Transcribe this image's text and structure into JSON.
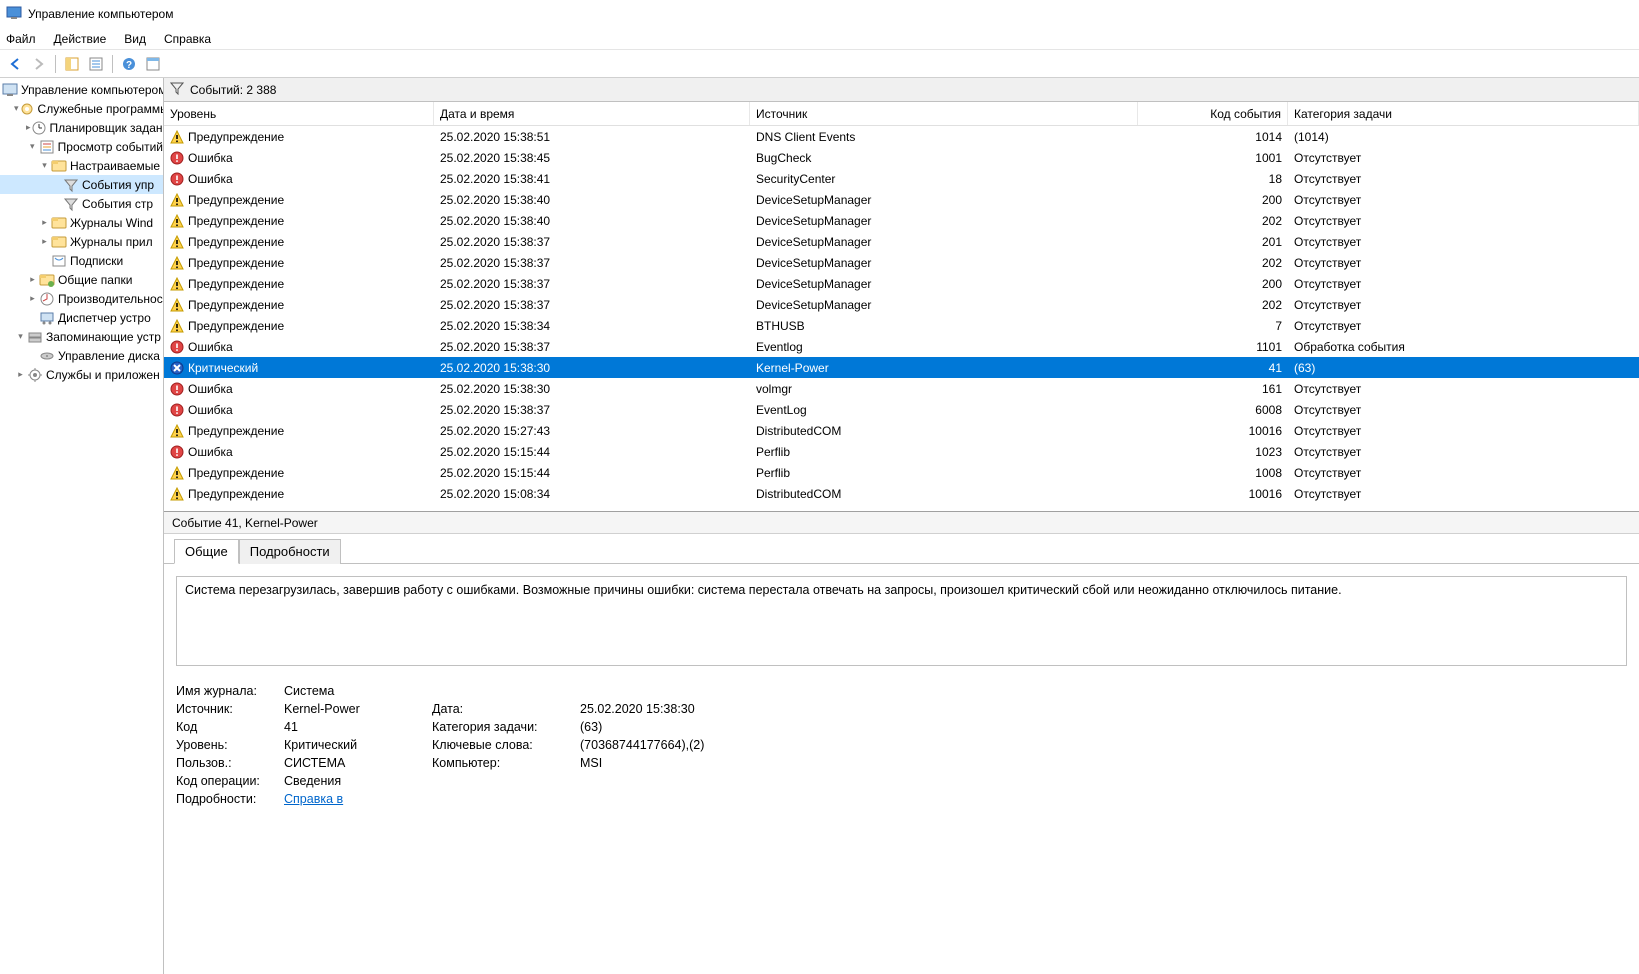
{
  "window_title": "Управление компьютером",
  "menu": {
    "file": "Файл",
    "action": "Действие",
    "view": "Вид",
    "help": "Справка"
  },
  "tree": [
    {
      "label": "Управление компьютером",
      "indent": 0,
      "icon": "computer-icon",
      "expander": ""
    },
    {
      "label": "Служебные программы",
      "indent": 1,
      "icon": "tools-icon",
      "expander": "▾"
    },
    {
      "label": "Планировщик заданий",
      "indent": 2,
      "icon": "scheduler-icon",
      "expander": "▸"
    },
    {
      "label": "Просмотр событий",
      "indent": 2,
      "icon": "eventviewer-icon",
      "expander": "▾"
    },
    {
      "label": "Настраиваемые",
      "indent": 3,
      "icon": "folder-icon",
      "expander": "▾"
    },
    {
      "label": "События управления",
      "indent": 4,
      "icon": "filter-icon",
      "expander": "",
      "selected": true,
      "short": "События упр"
    },
    {
      "label": "События строки",
      "indent": 4,
      "icon": "filter-icon",
      "expander": "",
      "short": "События стр"
    },
    {
      "label": "Журналы Windows",
      "indent": 3,
      "icon": "folder-icon",
      "expander": "▸",
      "short": "Журналы Wind"
    },
    {
      "label": "Журналы приложений",
      "indent": 3,
      "icon": "folder-icon",
      "expander": "▸",
      "short": "Журналы прил"
    },
    {
      "label": "Подписки",
      "indent": 3,
      "icon": "subs-icon",
      "expander": ""
    },
    {
      "label": "Общие папки",
      "indent": 2,
      "icon": "shared-icon",
      "expander": "▸"
    },
    {
      "label": "Производительность",
      "indent": 2,
      "icon": "perf-icon",
      "expander": "▸",
      "short": "Производительнос"
    },
    {
      "label": "Диспетчер устройств",
      "indent": 2,
      "icon": "devmgr-icon",
      "expander": "",
      "short": "Диспетчер устро"
    },
    {
      "label": "Запоминающие устройства",
      "indent": 1,
      "icon": "storage-icon",
      "expander": "▾",
      "short": "Запоминающие устр"
    },
    {
      "label": "Управление дисками",
      "indent": 2,
      "icon": "diskmgr-icon",
      "expander": "",
      "short": "Управление диска"
    },
    {
      "label": "Службы и приложения",
      "indent": 1,
      "icon": "services-icon",
      "expander": "▸",
      "short": "Службы и приложен"
    }
  ],
  "count_label": "Событий: 2 388",
  "columns": {
    "level": "Уровень",
    "date": "Дата и время",
    "source": "Источник",
    "code": "Код события",
    "category": "Категория задачи"
  },
  "events": [
    {
      "level": "warning",
      "level_text": "Предупреждение",
      "date": "25.02.2020 15:38:51",
      "source": "DNS Client Events",
      "code": "1014",
      "category": "(1014)"
    },
    {
      "level": "error",
      "level_text": "Ошибка",
      "date": "25.02.2020 15:38:45",
      "source": "BugCheck",
      "code": "1001",
      "category": "Отсутствует"
    },
    {
      "level": "error",
      "level_text": "Ошибка",
      "date": "25.02.2020 15:38:41",
      "source": "SecurityCenter",
      "code": "18",
      "category": "Отсутствует"
    },
    {
      "level": "warning",
      "level_text": "Предупреждение",
      "date": "25.02.2020 15:38:40",
      "source": "DeviceSetupManager",
      "code": "200",
      "category": "Отсутствует"
    },
    {
      "level": "warning",
      "level_text": "Предупреждение",
      "date": "25.02.2020 15:38:40",
      "source": "DeviceSetupManager",
      "code": "202",
      "category": "Отсутствует"
    },
    {
      "level": "warning",
      "level_text": "Предупреждение",
      "date": "25.02.2020 15:38:37",
      "source": "DeviceSetupManager",
      "code": "201",
      "category": "Отсутствует"
    },
    {
      "level": "warning",
      "level_text": "Предупреждение",
      "date": "25.02.2020 15:38:37",
      "source": "DeviceSetupManager",
      "code": "202",
      "category": "Отсутствует"
    },
    {
      "level": "warning",
      "level_text": "Предупреждение",
      "date": "25.02.2020 15:38:37",
      "source": "DeviceSetupManager",
      "code": "200",
      "category": "Отсутствует"
    },
    {
      "level": "warning",
      "level_text": "Предупреждение",
      "date": "25.02.2020 15:38:37",
      "source": "DeviceSetupManager",
      "code": "202",
      "category": "Отсутствует"
    },
    {
      "level": "warning",
      "level_text": "Предупреждение",
      "date": "25.02.2020 15:38:34",
      "source": "BTHUSB",
      "code": "7",
      "category": "Отсутствует"
    },
    {
      "level": "error",
      "level_text": "Ошибка",
      "date": "25.02.2020 15:38:37",
      "source": "Eventlog",
      "code": "1101",
      "category": "Обработка события"
    },
    {
      "level": "critical",
      "level_text": "Критический",
      "date": "25.02.2020 15:38:30",
      "source": "Kernel-Power",
      "code": "41",
      "category": "(63)",
      "selected": true
    },
    {
      "level": "error",
      "level_text": "Ошибка",
      "date": "25.02.2020 15:38:30",
      "source": "volmgr",
      "code": "161",
      "category": "Отсутствует"
    },
    {
      "level": "error",
      "level_text": "Ошибка",
      "date": "25.02.2020 15:38:37",
      "source": "EventLog",
      "code": "6008",
      "category": "Отсутствует"
    },
    {
      "level": "warning",
      "level_text": "Предупреждение",
      "date": "25.02.2020 15:27:43",
      "source": "DistributedCOM",
      "code": "10016",
      "category": "Отсутствует"
    },
    {
      "level": "error",
      "level_text": "Ошибка",
      "date": "25.02.2020 15:15:44",
      "source": "Perflib",
      "code": "1023",
      "category": "Отсутствует"
    },
    {
      "level": "warning",
      "level_text": "Предупреждение",
      "date": "25.02.2020 15:15:44",
      "source": "Perflib",
      "code": "1008",
      "category": "Отсутствует"
    },
    {
      "level": "warning",
      "level_text": "Предупреждение",
      "date": "25.02.2020 15:08:34",
      "source": "DistributedCOM",
      "code": "10016",
      "category": "Отсутствует"
    }
  ],
  "detail": {
    "title": "Событие 41, Kernel-Power",
    "tabs": {
      "general": "Общие",
      "details": "Подробности"
    },
    "message": "Система перезагрузилась, завершив работу с ошибками. Возможные причины ошибки: система перестала отвечать на запросы, произошел критический сбой или неожиданно отключилось питание.",
    "labels": {
      "log": "Имя журнала:",
      "source": "Источник:",
      "code": "Код",
      "level": "Уровень:",
      "user": "Пользов.:",
      "opcode": "Код операции:",
      "more": "Подробности:",
      "date": "Дата:",
      "category": "Категория задачи:",
      "keywords": "Ключевые слова:",
      "computer": "Компьютер:"
    },
    "values": {
      "log": "Система",
      "source": "Kernel-Power",
      "code": "41",
      "level": "Критический",
      "user": "СИСТЕМА",
      "opcode": "Сведения",
      "more_link": "Справка в",
      "date": "25.02.2020 15:38:30",
      "category": "(63)",
      "keywords": "(70368744177664),(2)",
      "computer": "MSI"
    }
  }
}
